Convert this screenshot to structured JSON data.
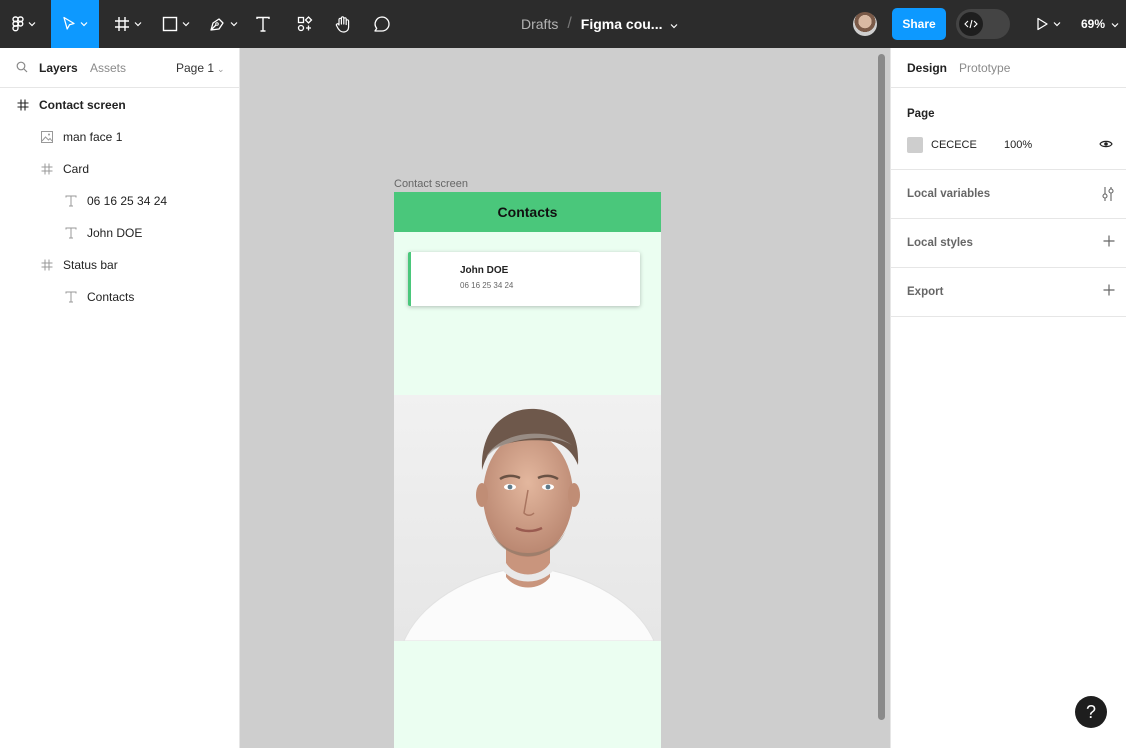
{
  "toolbar": {
    "breadcrumb_drafts": "Drafts",
    "breadcrumb_sep": "/",
    "file_name": "Figma cou...",
    "share_label": "Share",
    "zoom_level": "69%",
    "icons": [
      "figma-menu-icon",
      "move-tool-icon",
      "frame-tool-icon",
      "shape-tool-icon",
      "pen-tool-icon",
      "text-tool-icon",
      "resources-icon",
      "hand-tool-icon",
      "comment-icon",
      "dev-mode-icon",
      "present-icon"
    ]
  },
  "left_panel": {
    "tab_layers": "Layers",
    "tab_assets": "Assets",
    "page_selector": "Page 1",
    "layers": [
      {
        "label": "Contact screen",
        "type": "frame"
      },
      {
        "label": "man face 1",
        "type": "image"
      },
      {
        "label": "Card",
        "type": "frame"
      },
      {
        "label": "06 16 25 34 24",
        "type": "text"
      },
      {
        "label": "John DOE",
        "type": "text"
      },
      {
        "label": "Status bar",
        "type": "frame"
      },
      {
        "label": "Contacts",
        "type": "text"
      }
    ]
  },
  "canvas": {
    "background": "#CECECE",
    "frame_label": "Contact screen",
    "status_title": "Contacts",
    "card_name": "John DOE",
    "card_phone": "06 16 25 34 24",
    "accent": "#4AC77B",
    "frame_bg": "#EBFEF1"
  },
  "right_panel": {
    "tab_design": "Design",
    "tab_prototype": "Prototype",
    "page_title": "Page",
    "page_color": "CECECE",
    "page_opacity": "100%",
    "local_variables": "Local variables",
    "local_styles": "Local styles",
    "export": "Export"
  },
  "help_label": "?"
}
